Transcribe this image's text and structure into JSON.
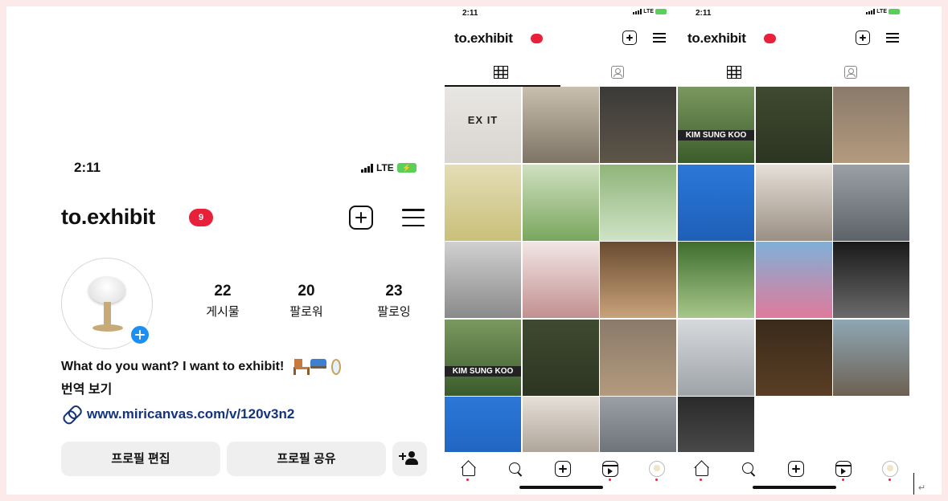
{
  "profile": {
    "time": "2:11",
    "carrier": "LTE",
    "handle": "to.exhibit",
    "badge": "9",
    "stats": [
      {
        "value": "22",
        "label": "게시물"
      },
      {
        "value": "20",
        "label": "팔로워"
      },
      {
        "value": "23",
        "label": "팔로잉"
      }
    ],
    "bio": "What do you want? I want to exhibit!",
    "translate": "번역 보기",
    "link": "www.miricanvas.com/v/120v3n2",
    "edit_button": "프로필 편집",
    "share_button": "프로필 공유"
  },
  "grid_panel_1": {
    "time": "2:11",
    "carrier": "LTE",
    "handle": "to.exhibit",
    "post_title": "EX IT",
    "posts": [
      {
        "top": "#e8e6e3",
        "bottom": "#d9d5d0"
      },
      {
        "top": "#c9bfae",
        "bottom": "#7d7466"
      },
      {
        "top": "#3b3a38",
        "bottom": "#5e5548"
      },
      {
        "top": "#e4ddb6",
        "bottom": "#c9c07a"
      },
      {
        "top": "#cfe0c0",
        "bottom": "#7aa75e"
      },
      {
        "top": "#8fb57a",
        "bottom": "#cfe3c6"
      },
      {
        "top": "#d0d0d0",
        "bottom": "#8a8a8a"
      },
      {
        "top": "#f2e6e4",
        "bottom": "#c29090"
      },
      {
        "top": "#6a4b30",
        "bottom": "#c8a27a"
      },
      {
        "top": "#7a9960",
        "bottom": "#3b5b2b"
      },
      {
        "top": "#3e4a30",
        "bottom": "#2c3522"
      },
      {
        "top": "#8a7a6a",
        "bottom": "#b39a7e"
      },
      {
        "top": "#2b78d8",
        "bottom": "#1e5fb8"
      },
      {
        "top": "#e7e0d8",
        "bottom": "#9a8f84"
      },
      {
        "top": "#9aa0a6",
        "bottom": "#5d6368"
      }
    ],
    "overlay_text": "KIM SUNG KOO"
  },
  "grid_panel_2": {
    "time": "2:11",
    "carrier": "LTE",
    "handle": "to.exhibit",
    "posts": [
      {
        "top": "#7a9960",
        "bottom": "#3b5b2b"
      },
      {
        "top": "#3e4a30",
        "bottom": "#2c3522"
      },
      {
        "top": "#8a7a6a",
        "bottom": "#b39a7e"
      },
      {
        "top": "#2b78d8",
        "bottom": "#1e5fb8"
      },
      {
        "top": "#e7e0d8",
        "bottom": "#9a8f84"
      },
      {
        "top": "#9aa0a6",
        "bottom": "#5d6368"
      },
      {
        "top": "#3e6e2e",
        "bottom": "#a7c78a"
      },
      {
        "top": "#7fb0d8",
        "bottom": "#e07a9a"
      },
      {
        "top": "#1a1a1a",
        "bottom": "#6a6a6a"
      },
      {
        "top": "#d7d9dc",
        "bottom": "#9ea3a8"
      },
      {
        "top": "#3a2a1a",
        "bottom": "#5a3e25"
      },
      {
        "top": "#8fa7b5",
        "bottom": "#6d6052"
      },
      {
        "top": "#2a2a2a",
        "bottom": "#545454"
      },
      null,
      null
    ],
    "overlay_text": "KIM SUNG KOO"
  },
  "colors": {
    "accent": "#1d8ff0",
    "badge": "#e8203a",
    "link": "#14347a",
    "background": "#fce9ea"
  }
}
